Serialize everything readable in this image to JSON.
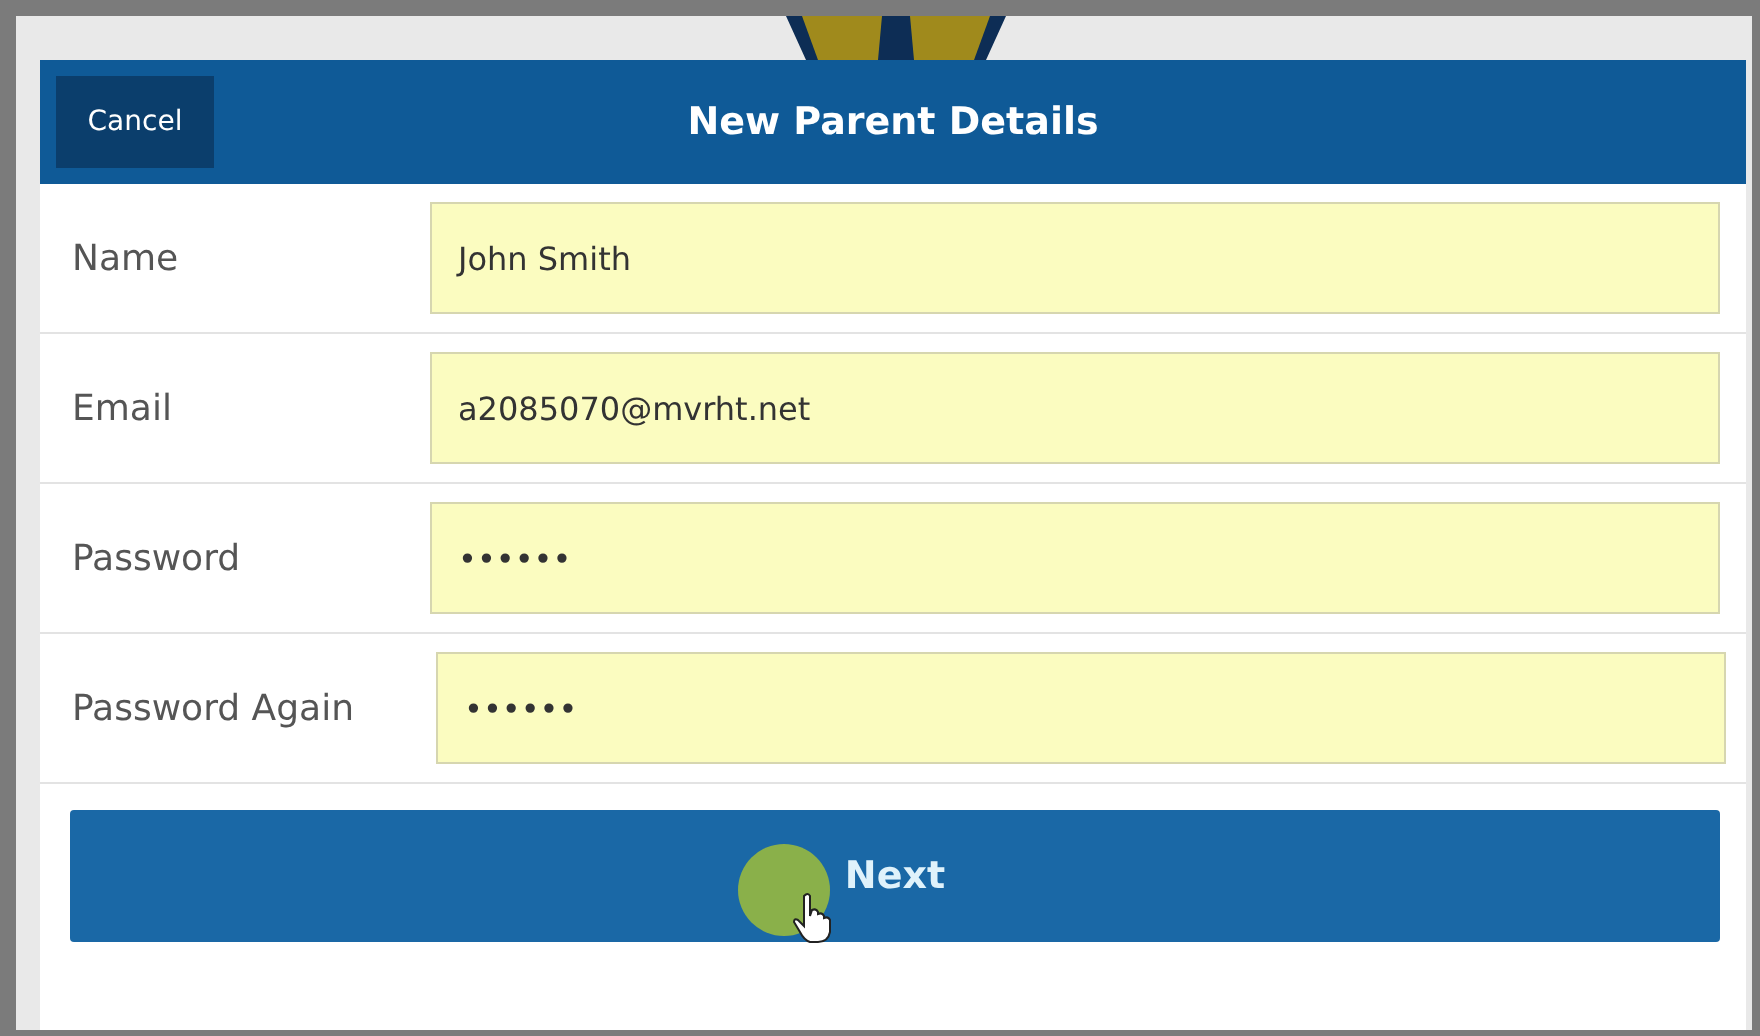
{
  "dialog": {
    "title": "New Parent Details",
    "cancel_button": "Cancel"
  },
  "fields": [
    {
      "label": "Name",
      "value": "John Smith"
    },
    {
      "label": "Email",
      "value": "a2085070@mvrht.net"
    },
    {
      "label": "Password",
      "value": "••••••"
    },
    {
      "label": "Password Again",
      "value": "••••••"
    }
  ],
  "next_button": "Next"
}
